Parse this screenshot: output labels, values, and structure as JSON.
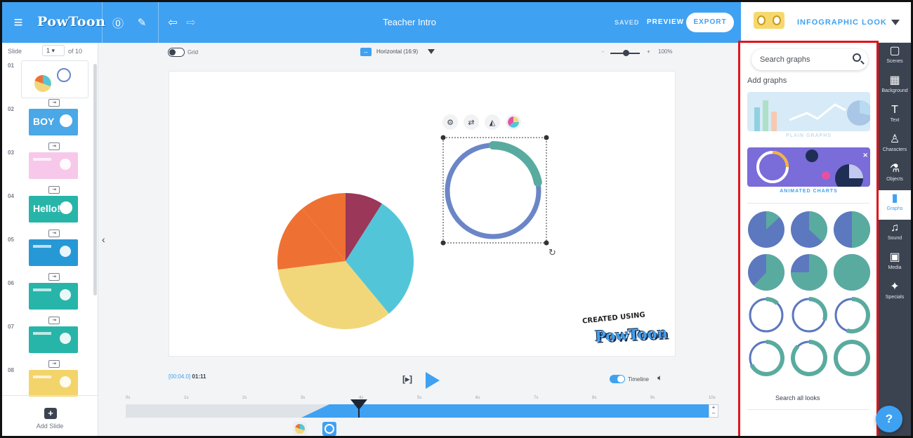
{
  "app": {
    "title": "Teacher Intro",
    "logo_text": "PowToon"
  },
  "toolbar": {
    "menu_icon": "hamburger-icon",
    "help_icon": "question-icon",
    "notes_icon": "notes-icon",
    "undo_icon": "undo-icon",
    "redo_icon": "redo-icon",
    "saved": "SAVED",
    "preview": "PREVIEW",
    "export": "EXPORT"
  },
  "look": {
    "label": "INFOGRAPHIC LOOK"
  },
  "slides": {
    "header": "Slide",
    "current": "1",
    "total": "of 10",
    "items": [
      {
        "num": "01",
        "bg": "#ffffff"
      },
      {
        "num": "02",
        "bg": "#4aa8e6",
        "text": "BOY"
      },
      {
        "num": "03",
        "bg": "#f7c8e9"
      },
      {
        "num": "04",
        "bg": "#27b5a9",
        "text": "Hello!"
      },
      {
        "num": "05",
        "bg": "#2798d6"
      },
      {
        "num": "06",
        "bg": "#27b5a9"
      },
      {
        "num": "07",
        "bg": "#27b5a9"
      },
      {
        "num": "08",
        "bg": "#f3d46b"
      }
    ],
    "add_label": "Add Slide"
  },
  "stage": {
    "grid_label": "Grid",
    "ratio": "Horizontal (16:9)",
    "zoom_minus": "-",
    "zoom_plus": "+",
    "zoom": "100%"
  },
  "canvas": {
    "watermark_top": "CREATED USING",
    "watermark_main": "PowToon"
  },
  "pie_chart": {
    "slices": [
      {
        "value": 9,
        "color": "#9b3758"
      },
      {
        "value": 30,
        "color": "#52c6d8"
      },
      {
        "value": 34,
        "color": "#f2d77a"
      },
      {
        "value": 16,
        "color": "#ee7133"
      },
      {
        "value": 11,
        "color": "#ee7133"
      }
    ]
  },
  "ring_chart": {
    "progress": 0.22,
    "track": "#6b86c7",
    "fill": "#5aab9f"
  },
  "playback": {
    "current": "[00:04.0]",
    "duration": "01:11",
    "play_box": "[▸]",
    "timeline_label": "Timeline"
  },
  "timeline": {
    "ticks": [
      "0s",
      "1s",
      "2s",
      "3s",
      "4s",
      "5s",
      "6s",
      "7s",
      "8s",
      "9s",
      "10s"
    ]
  },
  "panel": {
    "search_placeholder": "Search graphs",
    "section": "Add graphs",
    "plain_label": "PLAIN GRAPHS",
    "animated_label": "ANIMATED CHARTS",
    "search_all": "Search all looks"
  },
  "mini_charts": [
    {
      "kind": "pie",
      "frac": 0.13
    },
    {
      "kind": "pie",
      "frac": 0.37
    },
    {
      "kind": "pie",
      "frac": 0.5
    },
    {
      "kind": "pie",
      "frac": 0.62
    },
    {
      "kind": "pie",
      "frac": 0.75
    },
    {
      "kind": "pie",
      "frac": 1.0
    },
    {
      "kind": "ring",
      "frac": 0.12
    },
    {
      "kind": "ring",
      "frac": 0.3
    },
    {
      "kind": "ring",
      "frac": 0.55
    },
    {
      "kind": "ring",
      "frac": 0.68
    },
    {
      "kind": "ring",
      "frac": 0.88
    },
    {
      "kind": "ring",
      "frac": 1.0
    }
  ],
  "rail": [
    {
      "label": "Scenes",
      "icon": "▢"
    },
    {
      "label": "Background",
      "icon": "▦"
    },
    {
      "label": "Text",
      "icon": "T"
    },
    {
      "label": "Characters",
      "icon": "♙"
    },
    {
      "label": "Objects",
      "icon": "⚗"
    },
    {
      "label": "Graphs",
      "icon": "▮"
    },
    {
      "label": "Sound",
      "icon": "♫"
    },
    {
      "label": "Media",
      "icon": "▣"
    },
    {
      "label": "Specials",
      "icon": "✦"
    }
  ],
  "help": {
    "label": "?"
  }
}
